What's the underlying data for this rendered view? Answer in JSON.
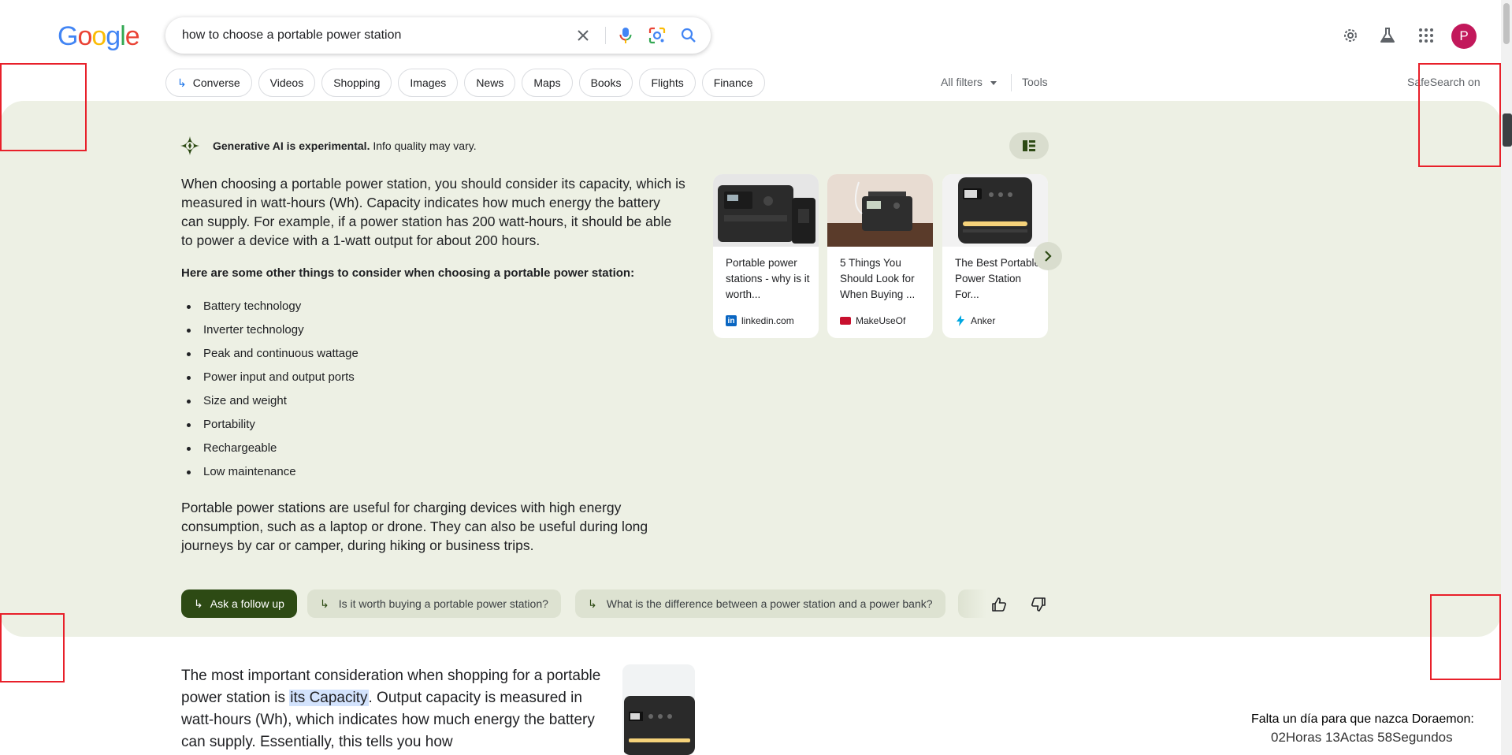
{
  "header": {
    "logo_text": "Google",
    "search": {
      "query": "how to choose a portable power station",
      "icons": [
        "close-icon",
        "microphone-icon",
        "lens-icon",
        "search-icon"
      ]
    },
    "right_icons": [
      "settings-gear-icon",
      "labs-flask-icon",
      "apps-grid-icon"
    ],
    "avatar_letter": "P"
  },
  "chips": [
    "Converse",
    "Videos",
    "Shopping",
    "Images",
    "News",
    "Maps",
    "Books",
    "Flights",
    "Finance"
  ],
  "filters": {
    "all_filters": "All filters",
    "tools": "Tools",
    "safesearch": "SafeSearch on"
  },
  "ai_overview": {
    "disclaimer_bold": "Generative AI is experimental.",
    "disclaimer_rest": " Info quality may vary.",
    "paragraph1": "When choosing a portable power station, you should consider its capacity, which is measured in watt-hours (Wh). Capacity indicates how much energy the battery can supply. For example, if a power station has 200 watt-hours, it should be able to power a device with a 1-watt output for about 200 hours.",
    "subheading": "Here are some other things to consider when choosing a portable power station:",
    "list": [
      "Battery technology",
      "Inverter technology",
      "Peak and continuous wattage",
      "Power input and output ports",
      "Size and weight",
      "Portability",
      "Rechargeable",
      "Low maintenance"
    ],
    "paragraph2": "Portable power stations are useful for charging devices with high energy consumption, such as a laptop or drone. They can also be useful during long journeys by car or camper, during hiking or business trips.",
    "cards": [
      {
        "title": "Portable power stations - why is it worth...",
        "source": "linkedin.com",
        "source_icon": "linkedin-icon"
      },
      {
        "title": "5 Things You Should Look for When Buying ...",
        "source": "MakeUseOf",
        "source_icon": "makeuseof-icon"
      },
      {
        "title": "The Best Portable Power Station For...",
        "source": "Anker",
        "source_icon": "anker-bolt-icon"
      }
    ],
    "ask_follow_up": "Ask a follow up",
    "follow_ups": [
      "Is it worth buying a portable power station?",
      "What is the difference between a power station and a power bank?"
    ]
  },
  "result": {
    "text_before": "The most important consideration when shopping for a portable power station is ",
    "highlight": "its Capacity",
    "text_after": ". Output capacity is measured in watt-hours (Wh), which indicates how much energy the battery can supply. Essentially, this tells you how"
  },
  "overlay": {
    "line1": "Falta un día para que nazca Doraemon:",
    "line2": "02Horas 13Actas 58Segundos"
  },
  "colors": {
    "ai_panel_bg": "#edf0e4",
    "ask_button_bg": "#2d4a14",
    "avatar_bg": "#c2185b",
    "annotation_red": "#e8202a"
  }
}
